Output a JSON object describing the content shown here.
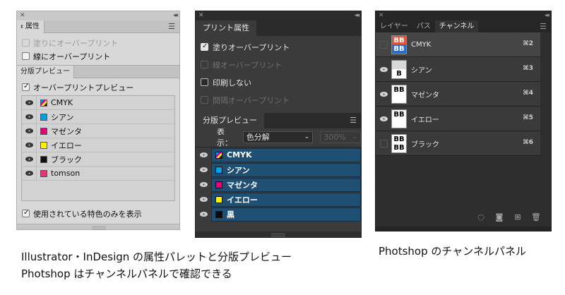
{
  "illustrator_panel": {
    "tab": "属性",
    "options": [
      {
        "label": "塗りにオーバープリント",
        "checked": false,
        "disabled": true
      },
      {
        "label": "線にオーバープリント",
        "checked": false,
        "disabled": false
      }
    ],
    "section_tab": "分版プレビュー",
    "overprint_preview": {
      "label": "オーバープリントプレビュー",
      "checked": true
    },
    "separations": [
      {
        "name": "CMYK",
        "color": "cmyk"
      },
      {
        "name": "シアン",
        "color": "#00a0e9"
      },
      {
        "name": "マゼンタ",
        "color": "#e4007f"
      },
      {
        "name": "イエロー",
        "color": "#fff100"
      },
      {
        "name": "ブラック",
        "color": "#111111"
      },
      {
        "name": "tomson",
        "color": "#e8307d"
      }
    ],
    "show_used_spot": {
      "label": "使用されている特色のみを表示",
      "checked": true
    }
  },
  "indesign_panel": {
    "tab": "プリント属性",
    "options": [
      {
        "label": "塗りオーバープリント",
        "checked": true,
        "disabled": false
      },
      {
        "label": "線オーバープリント",
        "checked": false,
        "disabled": true
      },
      {
        "label": "印刷しない",
        "checked": false,
        "disabled": false
      },
      {
        "label": "間隔オーバープリント",
        "checked": false,
        "disabled": true
      }
    ],
    "section_tab": "分版プレビュー",
    "view_label": "表示：",
    "view_value": "色分解",
    "zoom_value": "300%",
    "separations": [
      {
        "name": "CMYK",
        "color": "cmyk"
      },
      {
        "name": "シアン",
        "color": "#00a0e9"
      },
      {
        "name": "マゼンタ",
        "color": "#e4007f"
      },
      {
        "name": "イエロー",
        "color": "#fff100"
      },
      {
        "name": "黒",
        "color": "#0a0a0a"
      }
    ]
  },
  "photoshop_panel": {
    "tabs": [
      "レイヤー",
      "パス",
      "チャンネル"
    ],
    "active_tab": 2,
    "channels": [
      {
        "name": "CMYK",
        "shortcut": "⌘2",
        "visible": false,
        "top": "BB",
        "bottom": "BB",
        "top_bg": "#e2553a",
        "bottom_bg": "#2b6cc4",
        "top_fg": "#ffffff",
        "bottom_fg": "#ffffff"
      },
      {
        "name": "シアン",
        "shortcut": "⌘3",
        "visible": true,
        "top": "",
        "bottom": "B",
        "top_bg": "#d9d9d9",
        "bottom_bg": "#ffffff",
        "top_fg": "#000000",
        "bottom_fg": "#000000"
      },
      {
        "name": "マゼンタ",
        "shortcut": "⌘4",
        "visible": true,
        "top": "BB",
        "bottom": "",
        "top_bg": "#ffffff",
        "bottom_bg": "#ffffff",
        "top_fg": "#000000",
        "bottom_fg": "#000000"
      },
      {
        "name": "イエロー",
        "shortcut": "⌘5",
        "visible": true,
        "top": "BB",
        "bottom": "",
        "top_bg": "#ffffff",
        "bottom_bg": "#ffffff",
        "top_fg": "#000000",
        "bottom_fg": "#000000"
      },
      {
        "name": "ブラック",
        "shortcut": "⌘6",
        "visible": false,
        "top": "BB",
        "bottom": "BB",
        "top_bg": "#ffffff",
        "bottom_bg": "#ffffff",
        "top_fg": "#000000",
        "bottom_fg": "#000000"
      }
    ]
  },
  "captions": {
    "left_line1": "Illustrator・InDesign の属性パレットと分版プレビュー",
    "left_line2": "Photshop はチャンネルパネルで確認できる",
    "right": "Photshop のチャンネルパネル"
  }
}
